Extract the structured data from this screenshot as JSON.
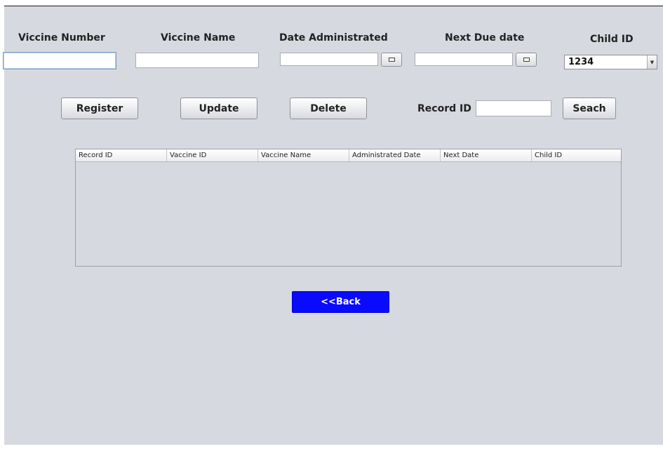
{
  "form": {
    "labels": {
      "vaccine_number": "Viccine Number",
      "vaccine_name": "Viccine Name",
      "date_administrated": "Date Administrated",
      "next_due_date": "Next Due date",
      "child_id": "Child ID"
    },
    "values": {
      "vaccine_number": "",
      "vaccine_name": "",
      "date_administrated": "",
      "next_due_date": ""
    },
    "child_id_selected": "1234"
  },
  "actions": {
    "register": "Register",
    "update": "Update",
    "delete": "Delete",
    "record_id_label": "Record ID",
    "record_id_value": "",
    "search": "Seach"
  },
  "table": {
    "columns": [
      "Record ID",
      "Vaccine ID",
      "Vaccine Name",
      "Administrated Date",
      "Next Date",
      "Child ID"
    ],
    "rows": []
  },
  "nav": {
    "back": "<<Back"
  },
  "colors": {
    "background": "#d6d9df",
    "back_button": "#0a0aff"
  },
  "icons": {
    "date_picker": "calendar-icon",
    "combo_arrow": "chevron-down-icon"
  }
}
